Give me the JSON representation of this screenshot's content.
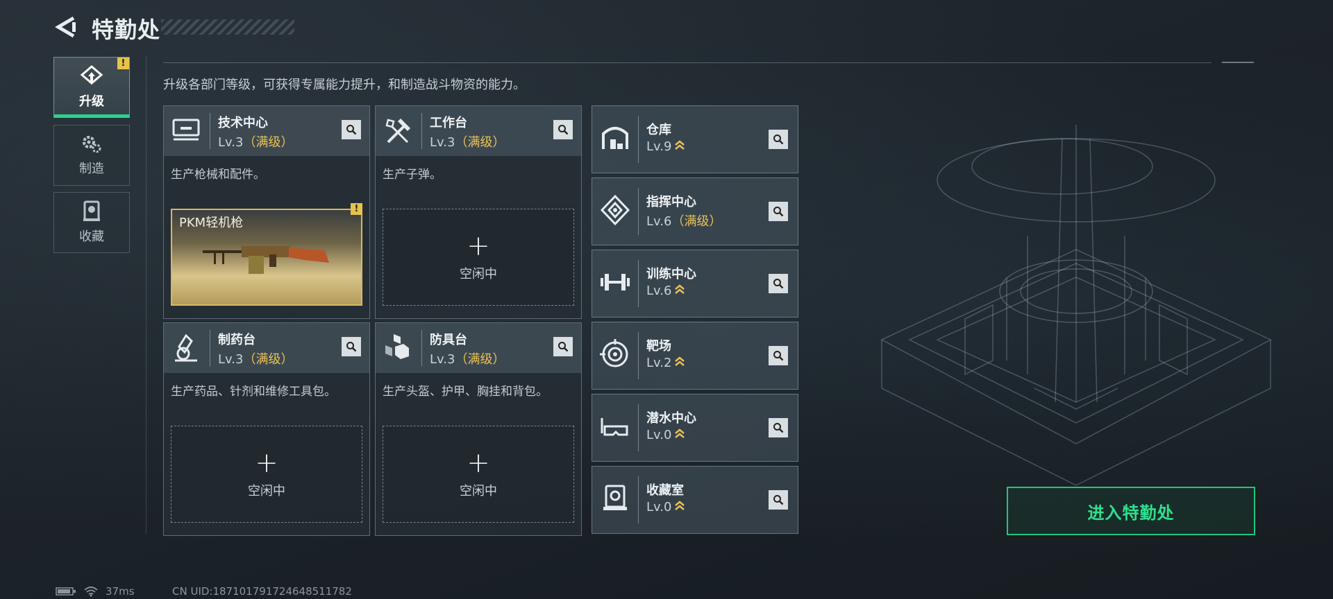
{
  "header": {
    "title": "特勤处"
  },
  "sidebar": {
    "items": [
      {
        "label": "升级",
        "icon": "upgrade-icon",
        "active": true,
        "warning": "!"
      },
      {
        "label": "制造",
        "icon": "gears-icon",
        "active": false
      },
      {
        "label": "收藏",
        "icon": "collection-icon",
        "active": false
      }
    ]
  },
  "main": {
    "description": "升级各部门等级，可获得专属能力提升，和制造战斗物资的能力。",
    "workshops": [
      {
        "name": "技术中心",
        "level": "Lv.3",
        "max": "（满级）",
        "desc": "生产枪械和配件。",
        "icon": "tech-center-icon",
        "slot": {
          "type": "item",
          "item_name": "PKM轻机枪",
          "warning": "!"
        }
      },
      {
        "name": "工作台",
        "level": "Lv.3",
        "max": "（满级）",
        "desc": "生产子弹。",
        "icon": "workbench-icon",
        "slot": {
          "type": "empty",
          "plus": "+",
          "idle": "空闲中"
        }
      },
      {
        "name": "制药台",
        "level": "Lv.3",
        "max": "（满级）",
        "desc": "生产药品、针剂和维修工具包。",
        "icon": "pharmacy-icon",
        "slot": {
          "type": "empty",
          "plus": "+",
          "idle": "空闲中"
        }
      },
      {
        "name": "防具台",
        "level": "Lv.3",
        "max": "（满级）",
        "desc": "生产头盔、护甲、胸挂和背包。",
        "icon": "armor-bench-icon",
        "slot": {
          "type": "empty",
          "plus": "+",
          "idle": "空闲中"
        }
      }
    ],
    "facilities": [
      {
        "name": "仓库",
        "level": "Lv.9",
        "max": "",
        "upgradable": true,
        "icon": "warehouse-icon"
      },
      {
        "name": "指挥中心",
        "level": "Lv.6",
        "max": "（满级）",
        "upgradable": false,
        "icon": "command-center-icon"
      },
      {
        "name": "训练中心",
        "level": "Lv.6",
        "max": "",
        "upgradable": true,
        "icon": "dumbbell-icon"
      },
      {
        "name": "靶场",
        "level": "Lv.2",
        "max": "",
        "upgradable": true,
        "icon": "target-icon"
      },
      {
        "name": "潜水中心",
        "level": "Lv.0",
        "max": "",
        "upgradable": true,
        "icon": "diving-mask-icon"
      },
      {
        "name": "收藏室",
        "level": "Lv.0",
        "max": "",
        "upgradable": true,
        "icon": "collection-room-icon"
      }
    ]
  },
  "actions": {
    "enter_label": "进入特勤处"
  },
  "status": {
    "ping": "37ms",
    "uid": "CN UID:18710179172464851178​2"
  },
  "colors": {
    "accent_green": "#2ad48a",
    "max_gold": "#e9c257",
    "warning": "#e6c34a"
  }
}
